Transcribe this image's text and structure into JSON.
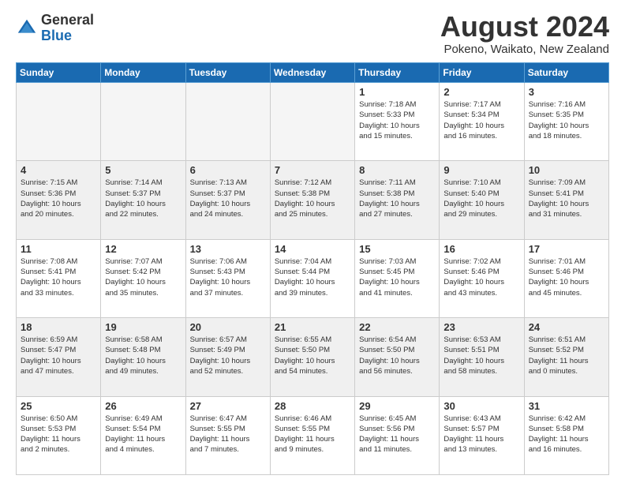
{
  "header": {
    "logo_general": "General",
    "logo_blue": "Blue",
    "title": "August 2024",
    "subtitle": "Pokeno, Waikato, New Zealand"
  },
  "days_of_week": [
    "Sunday",
    "Monday",
    "Tuesday",
    "Wednesday",
    "Thursday",
    "Friday",
    "Saturday"
  ],
  "weeks": [
    [
      {
        "day": "",
        "info": "",
        "empty": true
      },
      {
        "day": "",
        "info": "",
        "empty": true
      },
      {
        "day": "",
        "info": "",
        "empty": true
      },
      {
        "day": "",
        "info": "",
        "empty": true
      },
      {
        "day": "1",
        "info": "Sunrise: 7:18 AM\nSunset: 5:33 PM\nDaylight: 10 hours\nand 15 minutes."
      },
      {
        "day": "2",
        "info": "Sunrise: 7:17 AM\nSunset: 5:34 PM\nDaylight: 10 hours\nand 16 minutes."
      },
      {
        "day": "3",
        "info": "Sunrise: 7:16 AM\nSunset: 5:35 PM\nDaylight: 10 hours\nand 18 minutes."
      }
    ],
    [
      {
        "day": "4",
        "info": "Sunrise: 7:15 AM\nSunset: 5:36 PM\nDaylight: 10 hours\nand 20 minutes."
      },
      {
        "day": "5",
        "info": "Sunrise: 7:14 AM\nSunset: 5:37 PM\nDaylight: 10 hours\nand 22 minutes."
      },
      {
        "day": "6",
        "info": "Sunrise: 7:13 AM\nSunset: 5:37 PM\nDaylight: 10 hours\nand 24 minutes."
      },
      {
        "day": "7",
        "info": "Sunrise: 7:12 AM\nSunset: 5:38 PM\nDaylight: 10 hours\nand 25 minutes."
      },
      {
        "day": "8",
        "info": "Sunrise: 7:11 AM\nSunset: 5:38 PM\nDaylight: 10 hours\nand 27 minutes."
      },
      {
        "day": "9",
        "info": "Sunrise: 7:10 AM\nSunset: 5:40 PM\nDaylight: 10 hours\nand 29 minutes."
      },
      {
        "day": "10",
        "info": "Sunrise: 7:09 AM\nSunset: 5:41 PM\nDaylight: 10 hours\nand 31 minutes."
      }
    ],
    [
      {
        "day": "11",
        "info": "Sunrise: 7:08 AM\nSunset: 5:41 PM\nDaylight: 10 hours\nand 33 minutes."
      },
      {
        "day": "12",
        "info": "Sunrise: 7:07 AM\nSunset: 5:42 PM\nDaylight: 10 hours\nand 35 minutes."
      },
      {
        "day": "13",
        "info": "Sunrise: 7:06 AM\nSunset: 5:43 PM\nDaylight: 10 hours\nand 37 minutes."
      },
      {
        "day": "14",
        "info": "Sunrise: 7:04 AM\nSunset: 5:44 PM\nDaylight: 10 hours\nand 39 minutes."
      },
      {
        "day": "15",
        "info": "Sunrise: 7:03 AM\nSunset: 5:45 PM\nDaylight: 10 hours\nand 41 minutes."
      },
      {
        "day": "16",
        "info": "Sunrise: 7:02 AM\nSunset: 5:46 PM\nDaylight: 10 hours\nand 43 minutes."
      },
      {
        "day": "17",
        "info": "Sunrise: 7:01 AM\nSunset: 5:46 PM\nDaylight: 10 hours\nand 45 minutes."
      }
    ],
    [
      {
        "day": "18",
        "info": "Sunrise: 6:59 AM\nSunset: 5:47 PM\nDaylight: 10 hours\nand 47 minutes."
      },
      {
        "day": "19",
        "info": "Sunrise: 6:58 AM\nSunset: 5:48 PM\nDaylight: 10 hours\nand 49 minutes."
      },
      {
        "day": "20",
        "info": "Sunrise: 6:57 AM\nSunset: 5:49 PM\nDaylight: 10 hours\nand 52 minutes."
      },
      {
        "day": "21",
        "info": "Sunrise: 6:55 AM\nSunset: 5:50 PM\nDaylight: 10 hours\nand 54 minutes."
      },
      {
        "day": "22",
        "info": "Sunrise: 6:54 AM\nSunset: 5:50 PM\nDaylight: 10 hours\nand 56 minutes."
      },
      {
        "day": "23",
        "info": "Sunrise: 6:53 AM\nSunset: 5:51 PM\nDaylight: 10 hours\nand 58 minutes."
      },
      {
        "day": "24",
        "info": "Sunrise: 6:51 AM\nSunset: 5:52 PM\nDaylight: 11 hours\nand 0 minutes."
      }
    ],
    [
      {
        "day": "25",
        "info": "Sunrise: 6:50 AM\nSunset: 5:53 PM\nDaylight: 11 hours\nand 2 minutes."
      },
      {
        "day": "26",
        "info": "Sunrise: 6:49 AM\nSunset: 5:54 PM\nDaylight: 11 hours\nand 4 minutes."
      },
      {
        "day": "27",
        "info": "Sunrise: 6:47 AM\nSunset: 5:55 PM\nDaylight: 11 hours\nand 7 minutes."
      },
      {
        "day": "28",
        "info": "Sunrise: 6:46 AM\nSunset: 5:55 PM\nDaylight: 11 hours\nand 9 minutes."
      },
      {
        "day": "29",
        "info": "Sunrise: 6:45 AM\nSunset: 5:56 PM\nDaylight: 11 hours\nand 11 minutes."
      },
      {
        "day": "30",
        "info": "Sunrise: 6:43 AM\nSunset: 5:57 PM\nDaylight: 11 hours\nand 13 minutes."
      },
      {
        "day": "31",
        "info": "Sunrise: 6:42 AM\nSunset: 5:58 PM\nDaylight: 11 hours\nand 16 minutes."
      }
    ]
  ]
}
